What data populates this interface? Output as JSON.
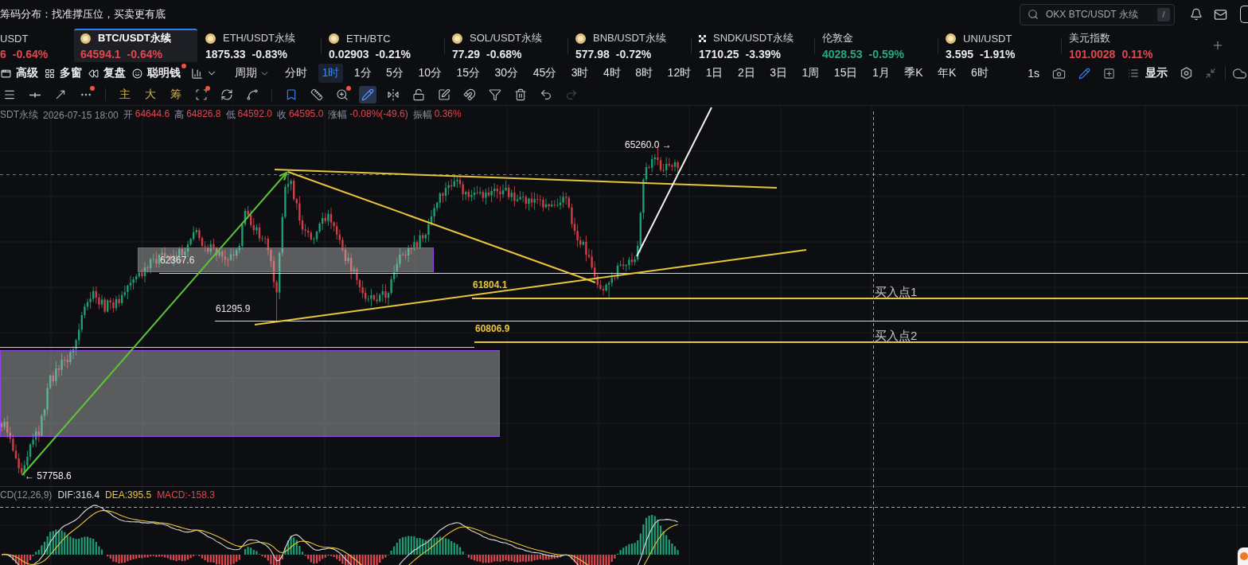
{
  "banner": "筹码分布：找准撑压位，买卖更有底",
  "search": {
    "placeholder": "OKX BTC/USDT 永续",
    "shortcut": "/"
  },
  "tickers": [
    {
      "kind": "plain",
      "name": "USDT",
      "price": "6",
      "change": "-0.64%",
      "color": "#e0474f",
      "selected": false
    },
    {
      "kind": "coin",
      "name": "BTC/USDT永续",
      "price": "64594.1",
      "change": "-0.64%",
      "color": "#e0474f",
      "selected": true
    },
    {
      "kind": "coin",
      "name": "ETH/USDT永续",
      "price": "1875.33",
      "change": "-0.83%",
      "color": "#e6e8eb",
      "selected": false
    },
    {
      "kind": "coin",
      "name": "ETH/BTC",
      "price": "0.02903",
      "change": "-0.21%",
      "color": "#e6e8eb",
      "selected": false
    },
    {
      "kind": "coin",
      "name": "SOL/USDT永续",
      "price": "77.29",
      "change": "-0.68%",
      "color": "#e6e8eb",
      "selected": false
    },
    {
      "kind": "coin",
      "name": "BNB/USDT永续",
      "price": "577.98",
      "change": "-0.72%",
      "color": "#e6e8eb",
      "selected": false
    },
    {
      "kind": "cross",
      "name": "SNDK/USDT永续",
      "price": "1710.25",
      "change": "-3.39%",
      "color": "#e6e8eb",
      "selected": false
    },
    {
      "kind": "plain",
      "name": "伦敦金",
      "price": "4028.53",
      "change": "-0.59%",
      "color": "#26a97c",
      "selected": false
    },
    {
      "kind": "coin",
      "name": "UNI/USDT",
      "price": "3.595",
      "change": "-1.91%",
      "color": "#e6e8eb",
      "selected": false
    },
    {
      "kind": "plain",
      "name": "美元指数",
      "price": "101.0028",
      "change": "0.11%",
      "color": "#e0474f",
      "selected": false
    }
  ],
  "toolbar": {
    "tools": [
      {
        "kind": "advanced",
        "label": "高级",
        "alert": false
      },
      {
        "kind": "windows",
        "label": "多窗",
        "alert": false
      },
      {
        "kind": "replay",
        "label": "复盘",
        "alert": false
      },
      {
        "kind": "money",
        "label": "聪明钱",
        "alert": true
      }
    ],
    "period": "周期",
    "intervals": [
      {
        "label": "分时",
        "selected": false
      },
      {
        "label": "1时",
        "selected": true
      },
      {
        "label": "1分",
        "selected": false
      },
      {
        "label": "5分",
        "selected": false
      },
      {
        "label": "10分",
        "selected": false
      },
      {
        "label": "15分",
        "selected": false
      },
      {
        "label": "30分",
        "selected": false
      },
      {
        "label": "45分",
        "selected": false
      },
      {
        "label": "3时",
        "selected": false
      },
      {
        "label": "4时",
        "selected": false
      },
      {
        "label": "8时",
        "selected": false
      },
      {
        "label": "12时",
        "selected": false
      },
      {
        "label": "1日",
        "selected": false
      },
      {
        "label": "2日",
        "selected": false
      },
      {
        "label": "3日",
        "selected": false
      },
      {
        "label": "1周",
        "selected": false
      },
      {
        "label": "15日",
        "selected": false
      },
      {
        "label": "1月",
        "selected": false
      },
      {
        "label": "季K",
        "selected": false
      },
      {
        "label": "年K",
        "selected": false
      },
      {
        "label": "6时",
        "selected": false
      }
    ],
    "tick": "1s",
    "drawing": true,
    "display": "显示"
  },
  "drawing_tools": [
    [
      {
        "kind": "menu",
        "selected": false,
        "on": false,
        "alert": false,
        "disabled": false
      },
      {
        "kind": "hline",
        "selected": false,
        "on": false,
        "alert": false,
        "disabled": false
      },
      {
        "kind": "ray",
        "selected": false,
        "on": false,
        "alert": false,
        "disabled": false
      },
      {
        "kind": "more",
        "selected": false,
        "on": false,
        "alert": true,
        "disabled": false
      }
    ],
    [
      {
        "kind": "text",
        "label": "主",
        "selected": false,
        "on": false,
        "alert": false,
        "disabled": false
      },
      {
        "kind": "text",
        "label": "大",
        "selected": false,
        "on": false,
        "alert": false,
        "disabled": false
      },
      {
        "kind": "text",
        "label": "筹",
        "selected": false,
        "on": false,
        "alert": false,
        "disabled": false
      },
      {
        "kind": "frame",
        "selected": false,
        "on": false,
        "alert": true,
        "disabled": false
      },
      {
        "kind": "sync",
        "selected": false,
        "on": false,
        "alert": false,
        "disabled": false
      },
      {
        "kind": "measure",
        "selected": false,
        "on": false,
        "alert": false,
        "disabled": false
      }
    ],
    [
      {
        "kind": "bookmark",
        "selected": false,
        "on": true,
        "alert": false,
        "disabled": false
      },
      {
        "kind": "ruler",
        "selected": false,
        "on": false,
        "alert": false,
        "disabled": false
      },
      {
        "kind": "zoom",
        "selected": false,
        "on": false,
        "alert": true,
        "disabled": false
      },
      {
        "kind": "pencil",
        "selected": true,
        "on": false,
        "alert": false,
        "disabled": false
      },
      {
        "kind": "pattern",
        "selected": false,
        "on": false,
        "alert": false,
        "disabled": false
      },
      {
        "kind": "lock",
        "selected": false,
        "on": false,
        "alert": false,
        "disabled": false
      },
      {
        "kind": "note",
        "selected": false,
        "on": false,
        "alert": false,
        "disabled": false
      },
      {
        "kind": "magnet",
        "selected": false,
        "on": false,
        "alert": false,
        "disabled": false
      },
      {
        "kind": "filter",
        "selected": false,
        "on": false,
        "alert": false,
        "disabled": false
      },
      {
        "kind": "trash",
        "selected": false,
        "on": false,
        "alert": false,
        "disabled": false
      },
      {
        "kind": "undo",
        "selected": false,
        "on": false,
        "alert": false,
        "disabled": false
      },
      {
        "kind": "redo",
        "selected": false,
        "on": false,
        "alert": false,
        "disabled": true
      }
    ]
  ],
  "chart": {
    "legend": {
      "symbol": "SDT永续",
      "time": "2026-07-15 18:00",
      "fields": [
        {
          "label": "开",
          "value": "64644.6"
        },
        {
          "label": "高",
          "value": "64826.8"
        },
        {
          "label": "低",
          "value": "64592.0"
        },
        {
          "label": "收",
          "value": "64595.0"
        },
        {
          "label": "涨幅",
          "value": "-0.08%(-49.6)"
        },
        {
          "label": "振幅",
          "value": "0.36%"
        }
      ]
    },
    "extremes": [
      {
        "kind": "high",
        "label": "65260.0 →"
      },
      {
        "kind": "low",
        "label": "← 57758.6"
      }
    ],
    "levels": [
      {
        "label": "62367.6"
      },
      {
        "label": "61295.9"
      }
    ],
    "buy_points": [
      {
        "price": "61804.1",
        "label": "买入点1"
      },
      {
        "price": "60806.9",
        "label": "买入点2"
      }
    ]
  },
  "macd": {
    "title": "CD(12,26,9)",
    "series": [
      {
        "label": "DIF:316.4",
        "color": "#d6d8db"
      },
      {
        "label": "DEA:395.5",
        "color": "#e8c53a"
      },
      {
        "label": "MACD:-158.3",
        "color": "#e0474f"
      }
    ]
  }
}
